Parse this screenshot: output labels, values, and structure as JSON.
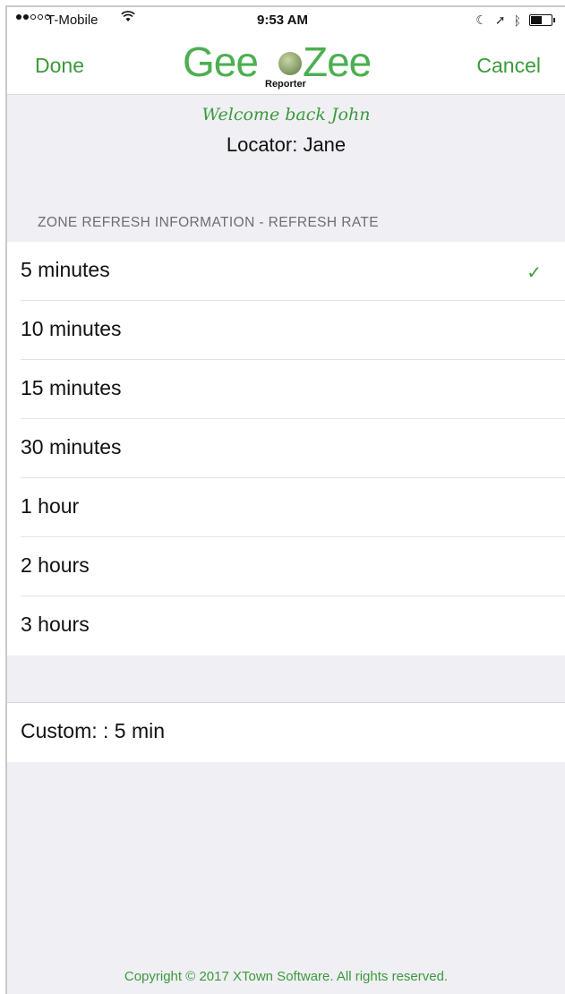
{
  "status_bar": {
    "carrier": "T-Mobile",
    "time": "9:53 AM",
    "wifi_icon": "wifi-icon",
    "moon_icon": "moon-icon",
    "location_icon": "location-arrow-icon",
    "bluetooth_icon": "bluetooth-icon",
    "battery_icon": "battery-icon"
  },
  "nav": {
    "done_label": "Done",
    "cancel_label": "Cancel",
    "logo_left": "Gee",
    "logo_right": "Zee",
    "logo_sub": "Reporter"
  },
  "greeting": {
    "welcome": "Welcome back John",
    "locator": "Locator: Jane"
  },
  "section": {
    "header": "ZONE REFRESH INFORMATION - REFRESH RATE"
  },
  "options": [
    {
      "label": "5 minutes",
      "selected": true
    },
    {
      "label": "10 minutes",
      "selected": false
    },
    {
      "label": "15 minutes",
      "selected": false
    },
    {
      "label": "30 minutes",
      "selected": false
    },
    {
      "label": "1 hour",
      "selected": false
    },
    {
      "label": "2 hours",
      "selected": false
    },
    {
      "label": "3 hours",
      "selected": false
    }
  ],
  "check_glyph": "✓",
  "custom": {
    "label": "Custom: : 5 min"
  },
  "footer": {
    "copyright": "Copyright ©  2017 XTown Software. All rights reserved."
  },
  "colors": {
    "accent": "#3c9a3c",
    "logo": "#4caf50",
    "background": "#efeff4"
  }
}
